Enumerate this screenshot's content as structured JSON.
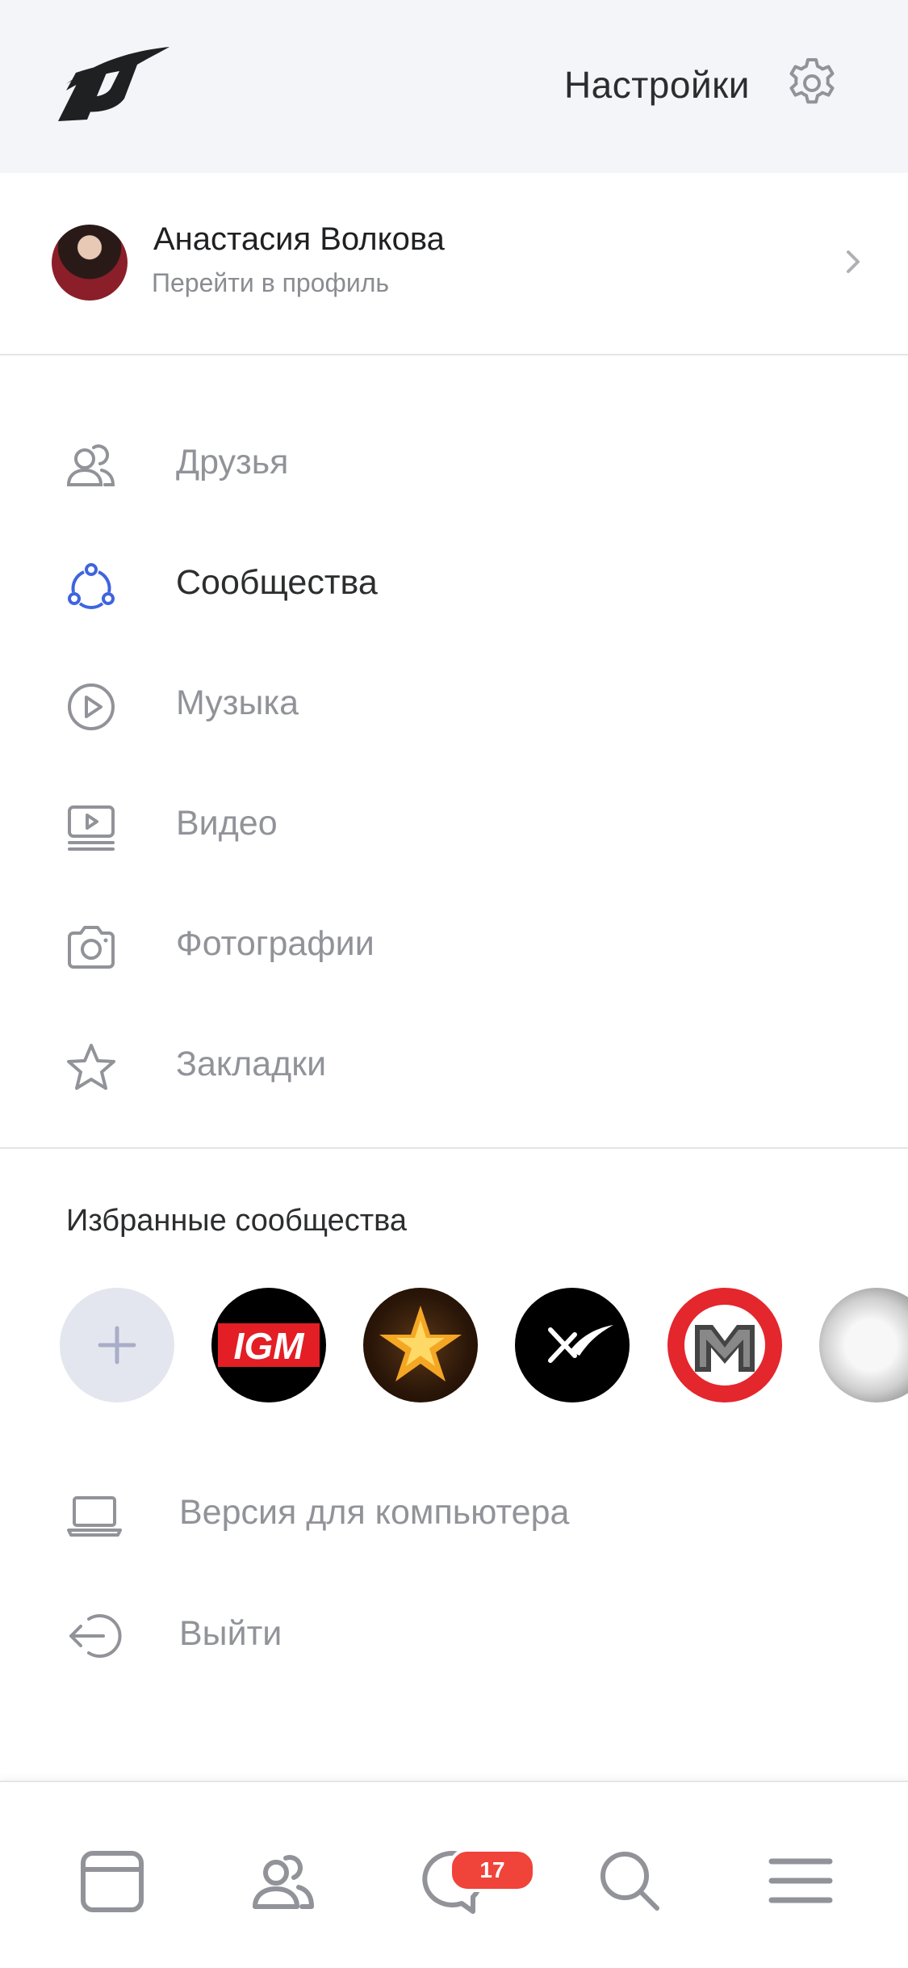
{
  "header": {
    "title": "Настройки",
    "logo_icon": "stylized-logo-icon",
    "settings_icon": "gear-icon"
  },
  "profile": {
    "name": "Анастасия Волкова",
    "subtitle": "Перейти в профиль"
  },
  "menu": {
    "items": [
      {
        "label": "Друзья",
        "icon": "friends-icon"
      },
      {
        "label": "Сообщества",
        "icon": "communities-icon",
        "active": true
      },
      {
        "label": "Музыка",
        "icon": "play-circle-icon"
      },
      {
        "label": "Видео",
        "icon": "video-icon"
      },
      {
        "label": "Фотографии",
        "icon": "camera-icon"
      },
      {
        "label": "Закладки",
        "icon": "star-icon"
      }
    ]
  },
  "favorites": {
    "title": "Избранные сообщества",
    "items": [
      {
        "name": "add",
        "icon": "plus-icon"
      },
      {
        "name": "IGM",
        "text": "IGM"
      },
      {
        "name": "star-community"
      },
      {
        "name": "x-community"
      },
      {
        "name": "red-m-community"
      },
      {
        "name": "silver-community"
      }
    ]
  },
  "extra": {
    "desktop_version": "Версия для компьютера",
    "logout": "Выйти"
  },
  "tabbar": {
    "messages_badge": "17"
  },
  "colors": {
    "header_bg": "#f4f5f9",
    "accent_blue": "#3f64e0",
    "icon_gray": "#919399",
    "badge_red": "#f0433a"
  }
}
